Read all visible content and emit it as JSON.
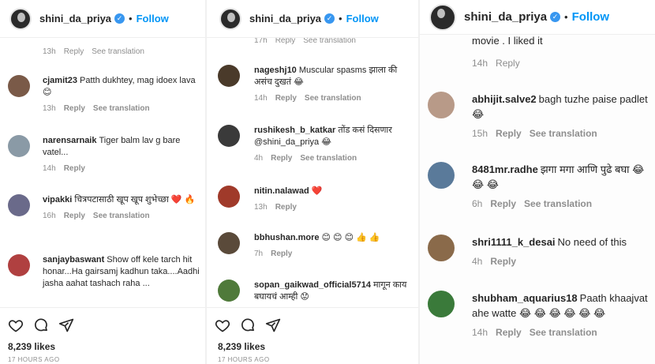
{
  "account": {
    "username": "shini_da_priya",
    "verified": "✓",
    "separator": "•",
    "follow": "Follow"
  },
  "labels": {
    "reply": "Reply",
    "see_translation": "See translation"
  },
  "panel1": {
    "top_meta": {
      "time": "13h"
    },
    "comments": [
      {
        "user": "cjamit23",
        "text": "Patth dukhtey, mag idoex lava 😊",
        "time": "13h"
      },
      {
        "user": "narensarnaik",
        "text": "Tiger balm lav g bare vatel...",
        "time": "14h"
      },
      {
        "user": "vipakki",
        "text": "चित्रपटासाठी खूप खूप शुभेच्छा ❤️ 🔥",
        "time": "16h"
      },
      {
        "user": "sanjaybaswant",
        "text": "Show off kele tarch hit honar...Ha gairsamj kadhun taka....Aadhi jasha aahat tashach raha ..."
      }
    ],
    "likes": "8,239 likes",
    "ago": "17 HOURS AGO"
  },
  "panel2": {
    "top_meta": {
      "time": "17h"
    },
    "comments": [
      {
        "user": "nageshj10",
        "text": "Muscular spasms झाला की असंच दुखतं 😂",
        "time": "14h"
      },
      {
        "user": "rushikesh_b_katkar",
        "text": "तोंड कसं दिसणार @shini_da_priya 😂",
        "time": "4h"
      },
      {
        "user": "nitin.nalawad",
        "text": "❤️",
        "time": "13h"
      },
      {
        "user": "bbhushan.more",
        "text": "😊 😊 😊 👍 👍",
        "time": "7h"
      },
      {
        "user": "sopan_gaikwad_official5714",
        "text": "मागून काय बघायचं आम्ही 😟"
      }
    ],
    "likes": "8,239 likes",
    "ago": "17 HOURS AGO"
  },
  "panel3": {
    "top_text": "movie . I liked it",
    "top_meta": {
      "time": "14h"
    },
    "comments": [
      {
        "user": "abhijit.salve2",
        "text": "bagh tuzhe paise padlet😂",
        "time": "15h"
      },
      {
        "user": "8481mr.radhe",
        "text": "झगा मगा आणि पुढे बघा 😂 😂 😂",
        "time": "6h"
      },
      {
        "user": "shri1111_k_desai",
        "text": "No need of this",
        "time": "4h"
      },
      {
        "user": "shubham_aquarius18",
        "text": "Paath khaajvat ahe watte 😂 😂 😂 😂 😂 😂",
        "time": "14h"
      }
    ]
  },
  "colors": {
    "follow": "#0095f6",
    "verified": "#3897f0",
    "meta": "#8e8e8e",
    "text": "#262626"
  },
  "icons": [
    "heart-icon",
    "comment-icon",
    "share-icon",
    "bookmark-icon"
  ]
}
